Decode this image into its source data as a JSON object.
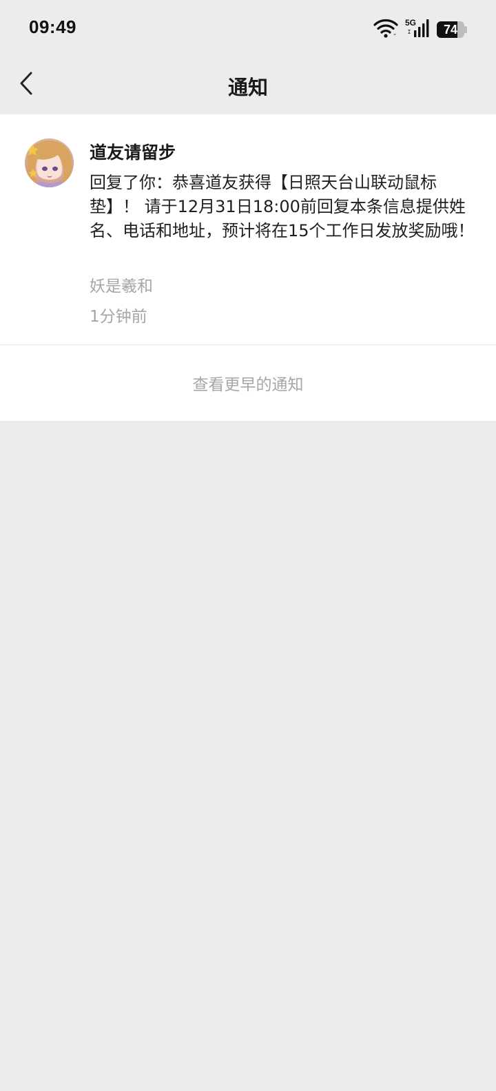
{
  "status_bar": {
    "time": "09:49",
    "network": "5G",
    "battery": "74",
    "battery_level": 0.74,
    "icons": [
      "wifi-icon",
      "signal-icon",
      "battery-icon"
    ]
  },
  "header": {
    "title": "通知",
    "back_icon": "chevron-left-icon"
  },
  "notifications": [
    {
      "sender": "道友请留步",
      "message": "回复了你：恭喜道友获得【日照天台山联动鼠标垫】！ 请于12月31日18:00前回复本条信息提供姓名、电话和地址，预计将在15个工作日发放奖励哦！",
      "source": "妖是羲和",
      "time": "1分钟前"
    }
  ],
  "footer": {
    "view_earlier": "查看更早的通知"
  },
  "colors": {
    "background": "#ececec",
    "card": "#ffffff",
    "text_primary": "#1a1a1a",
    "text_secondary": "#a6a6a6",
    "divider": "#ebebeb"
  }
}
